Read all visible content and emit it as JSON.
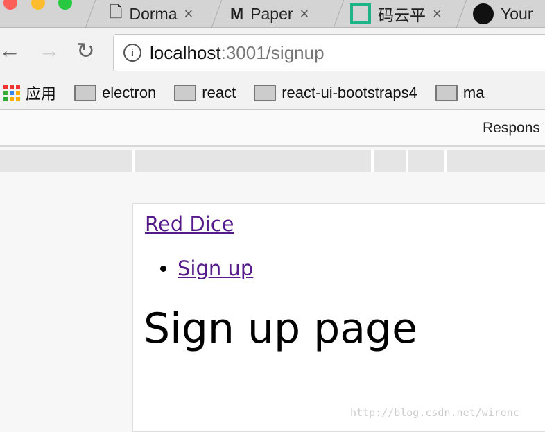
{
  "tabs": [
    {
      "title": "Dorma",
      "icon": "document-icon"
    },
    {
      "title": "Paper",
      "icon": "material-ui-icon"
    },
    {
      "title": "码云平",
      "icon": "gitee-icon"
    },
    {
      "title": "Your",
      "icon": "github-icon"
    }
  ],
  "close_glyph": "×",
  "address": {
    "host": "localhost",
    "path": ":3001/signup"
  },
  "bookmarks": {
    "apps": "应用",
    "items": [
      "electron",
      "react",
      "react-ui-bootstraps4",
      "ma"
    ]
  },
  "devtools": {
    "device": "Respons"
  },
  "page": {
    "brand": "Red Dice",
    "nav": [
      "Sign up"
    ],
    "heading": "Sign up page"
  },
  "watermark": "http://blog.csdn.net/wirenc"
}
